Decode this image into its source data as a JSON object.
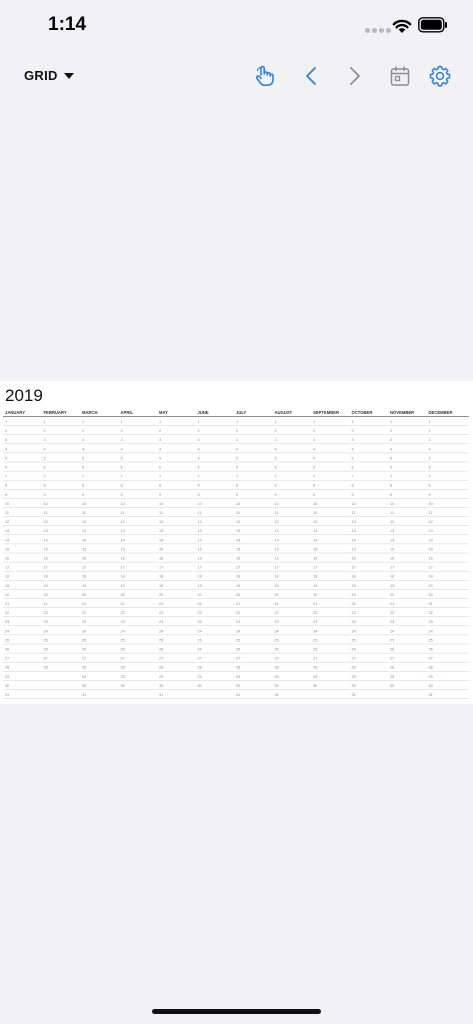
{
  "status": {
    "time": "1:14"
  },
  "nav": {
    "view_label": "GRID",
    "icons": [
      "hand-pointer-icon",
      "chevron-left-icon",
      "chevron-right-icon",
      "calendar-icon",
      "gear-icon"
    ]
  },
  "calendar": {
    "year": "2019",
    "months": [
      "JANUARY",
      "FEBRUARY",
      "MARCH",
      "APRIL",
      "MAY",
      "JUNE",
      "JULY",
      "AUGUST",
      "SEPTEMBER",
      "OCTOBER",
      "NOVEMBER",
      "DECEMBER"
    ],
    "days_in_month": [
      31,
      28,
      31,
      30,
      31,
      30,
      31,
      31,
      30,
      31,
      30,
      31
    ],
    "highlight": {
      "month": 12,
      "day": 30
    }
  },
  "colors": {
    "accent": "#2f7fe0",
    "inactive": "#8e8e93",
    "background": "#f2f1f6",
    "highlight": "#3b8ee8"
  }
}
